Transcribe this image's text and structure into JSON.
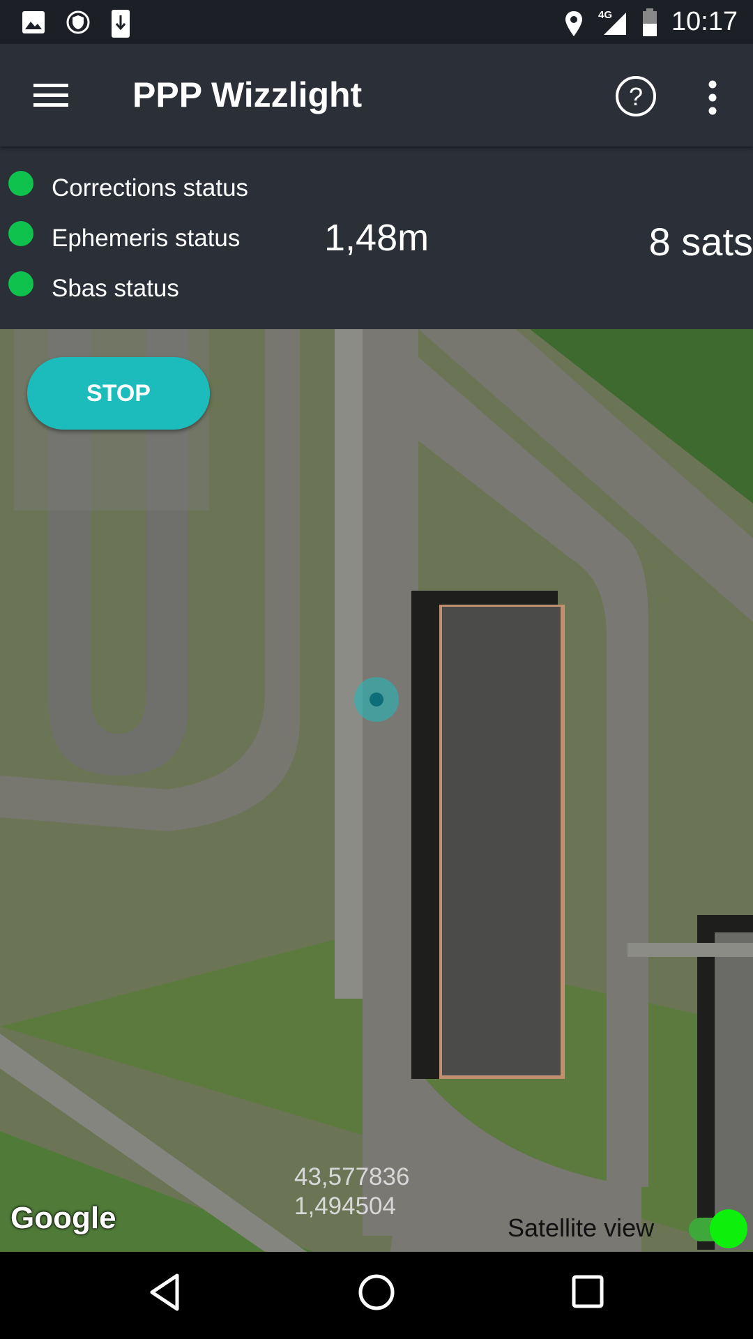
{
  "status_bar": {
    "time": "10:17",
    "network": "4G",
    "icons": [
      "image-icon",
      "vpn-shield-icon",
      "download-icon",
      "location-pin-icon",
      "signal-icon",
      "battery-icon"
    ]
  },
  "app_bar": {
    "title": "PPP Wizzlight",
    "icons": [
      "menu-icon",
      "help-icon",
      "more-vert-icon"
    ]
  },
  "status_panel": {
    "items": [
      {
        "label": "Corrections status",
        "color": "#0ec24d"
      },
      {
        "label": "Ephemeris status",
        "color": "#0ec24d"
      },
      {
        "label": "Sbas status",
        "color": "#0ec24d"
      }
    ],
    "accuracy": "1,48m",
    "satellites": "8 sats"
  },
  "map": {
    "stop_label": "STOP",
    "latitude": "43,577836",
    "longitude": "1,494504",
    "attribution": "Google",
    "satellite_view_label": "Satellite view",
    "satellite_view_on": true,
    "accent": "#1cbcbc"
  },
  "nav_bar": {
    "icons": [
      "back-icon",
      "home-icon",
      "recents-icon"
    ]
  }
}
